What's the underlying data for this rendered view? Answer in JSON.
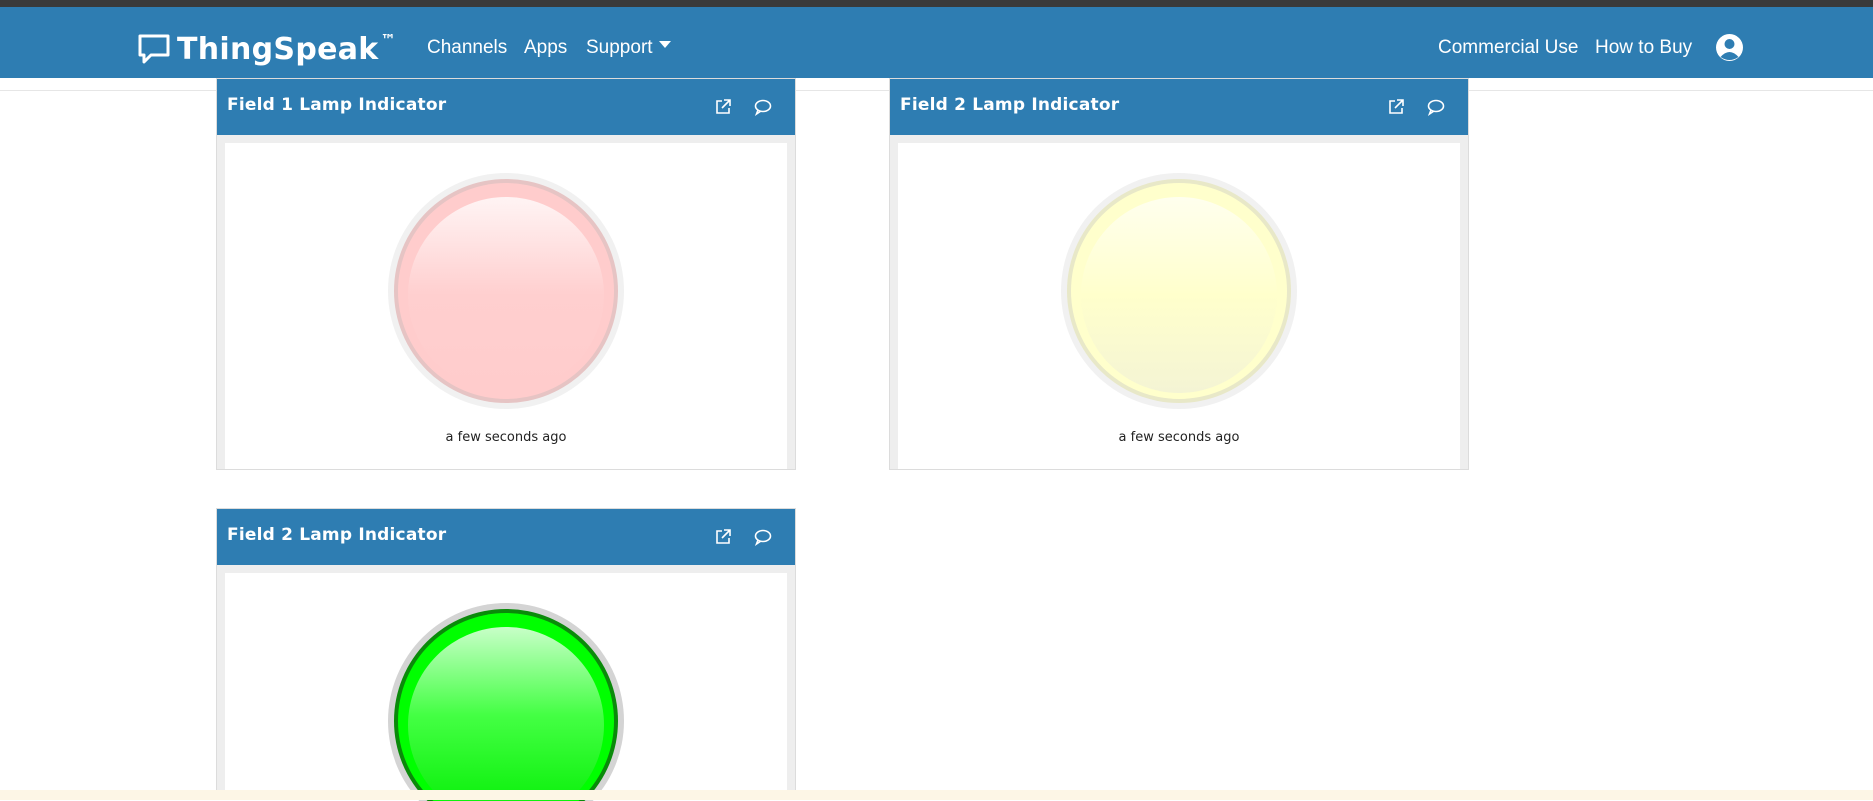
{
  "navbar": {
    "brand": "ThingSpeak",
    "trademark": "™",
    "links": [
      {
        "label": "Channels"
      },
      {
        "label": "Apps"
      },
      {
        "label": "Support"
      }
    ],
    "right_links": [
      {
        "label": "Commercial Use"
      },
      {
        "label": "How to Buy"
      }
    ],
    "brand_color": "#2e7db2"
  },
  "widgets": [
    {
      "title": "Field 1 Lamp Indicator",
      "timestamp": "a few seconds ago",
      "lamp_color": "#ffcccc",
      "lamp_state": "off"
    },
    {
      "title": "Field 2 Lamp Indicator",
      "timestamp": "a few seconds ago",
      "lamp_color": "#ffffcc",
      "lamp_state": "off"
    },
    {
      "title": "Field 2 Lamp Indicator",
      "timestamp": "",
      "lamp_color": "#00ff00",
      "lamp_state": "on"
    }
  ],
  "icons": {
    "logo": "chat-bubble-icon",
    "external": "external-link-icon",
    "comment": "comment-icon",
    "user": "user-avatar-icon"
  }
}
